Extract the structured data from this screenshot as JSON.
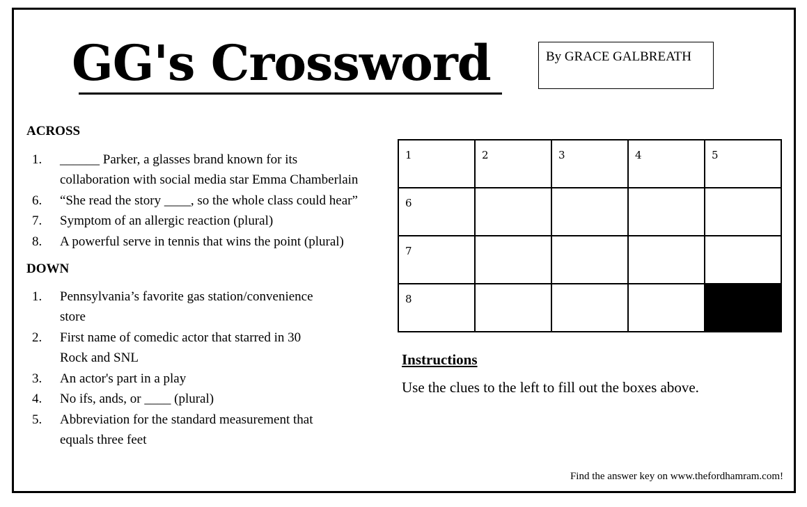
{
  "title": "GG's Crossword",
  "byline": "By GRACE GALBREATH",
  "across": {
    "heading": "ACROSS",
    "clues": [
      {
        "num": "1.",
        "lines": [
          "______ Parker, a glasses brand known for its",
          "collaboration with social media star Emma Chamberlain"
        ]
      },
      {
        "num": "6.",
        "lines": [
          "“She read the story ____, so the whole class could hear”"
        ]
      },
      {
        "num": "7.",
        "lines": [
          "Symptom of an allergic reaction (plural)"
        ]
      },
      {
        "num": "8.",
        "lines": [
          "A powerful serve in tennis that wins the point (plural)"
        ]
      }
    ]
  },
  "down": {
    "heading": "DOWN",
    "clues": [
      {
        "num": "1.",
        "lines": [
          "Pennsylvania’s favorite gas station/convenience",
          "store"
        ]
      },
      {
        "num": "2.",
        "lines": [
          "First name of comedic actor that starred in 30",
          "Rock and SNL"
        ]
      },
      {
        "num": "3.",
        "lines": [
          "An actor's part in a play"
        ]
      },
      {
        "num": "4.",
        "lines": [
          "No ifs, ands, or ____ (plural)"
        ]
      },
      {
        "num": "5.",
        "lines": [
          "Abbreviation for the standard measurement that",
          "equals three feet"
        ]
      }
    ]
  },
  "grid": {
    "rows": 4,
    "cols": 5,
    "cells": [
      [
        "1",
        "2",
        "3",
        "4",
        "5"
      ],
      [
        "6",
        "",
        "",
        "",
        ""
      ],
      [
        "7",
        "",
        "",
        "",
        ""
      ],
      [
        "8",
        "",
        "",
        "",
        "#"
      ]
    ]
  },
  "instructions": {
    "heading": "Instructions",
    "text": "Use the clues to the left to fill out the boxes above."
  },
  "footer": "Find the answer key on www.thefordhamram.com!"
}
